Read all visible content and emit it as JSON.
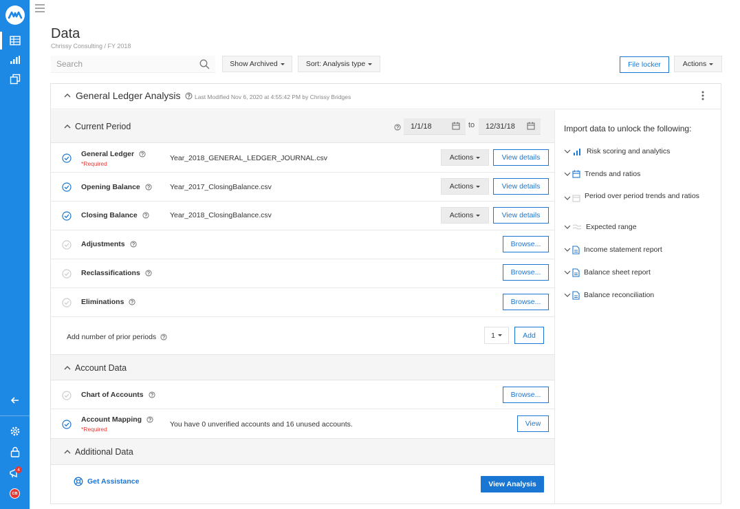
{
  "page": {
    "title": "Data",
    "breadcrumb": "Chrissy Consulting / FY 2018"
  },
  "colors": {
    "rail": "#1e88e5",
    "accent": "#1976d2",
    "check": "#1976d2",
    "badge": "#e53935"
  },
  "rail": {
    "icons": [
      "logo-icon",
      "table-icon",
      "bar-chart-icon",
      "layers-icon",
      "collapse-arrow-icon",
      "gear-icon",
      "lock-icon",
      "announcement-icon",
      "avatar"
    ],
    "badge_count": "4",
    "avatar_initials": "CB"
  },
  "toolbar": {
    "search_placeholder": "Search",
    "show_archived": "Show Archived",
    "sort": "Sort: Analysis type",
    "file_locker": "File locker",
    "actions": "Actions"
  },
  "card": {
    "title": "General Ledger Analysis",
    "modified": "Last Modified Nov 6, 2020 at 4:55:42 PM by Chrissy Bridges"
  },
  "current_period": {
    "heading": "Current Period",
    "from": "1/1/18",
    "to_label": "to",
    "to": "12/31/18",
    "rows": [
      {
        "name": "General Ledger",
        "required": "*Required",
        "file": "Year_2018_GENERAL_LEDGER_JOURNAL.csv",
        "actions": "Actions",
        "view": "View details"
      },
      {
        "name": "Opening Balance",
        "file": "Year_2017_ClosingBalance.csv",
        "actions": "Actions",
        "view": "View details"
      },
      {
        "name": "Closing Balance",
        "file": "Year_2018_ClosingBalance.csv",
        "actions": "Actions",
        "view": "View details"
      },
      {
        "name": "Adjustments",
        "browse": "Browse..."
      },
      {
        "name": "Reclassifications",
        "browse": "Browse..."
      },
      {
        "name": "Eliminations",
        "browse": "Browse..."
      }
    ],
    "prior": {
      "label": "Add number of prior periods",
      "count": "1",
      "add": "Add"
    }
  },
  "account_data": {
    "heading": "Account Data",
    "rows": [
      {
        "name": "Chart of Accounts",
        "browse": "Browse..."
      },
      {
        "name": "Account Mapping",
        "required": "*Required",
        "message": "You have 0 unverified accounts and 16 unused accounts.",
        "view": "View"
      }
    ]
  },
  "additional_data": {
    "heading": "Additional Data"
  },
  "footer": {
    "assist": "Get Assistance",
    "view_analysis": "View Analysis"
  },
  "import_panel": {
    "title": "Import data to unlock the following:",
    "items": [
      {
        "label": "Risk scoring and analytics",
        "icon": "bar-chart-icon"
      },
      {
        "label": "Trends and ratios",
        "icon": "calendar-icon"
      },
      {
        "label": "Period over period trends and ratios",
        "icon": "calendar-icon"
      },
      {
        "label": "Expected range",
        "icon": "wave-icon"
      },
      {
        "label": "Income statement report",
        "icon": "document-icon"
      },
      {
        "label": "Balance sheet report",
        "icon": "document-icon"
      },
      {
        "label": "Balance reconciliation",
        "icon": "document-icon"
      }
    ]
  }
}
